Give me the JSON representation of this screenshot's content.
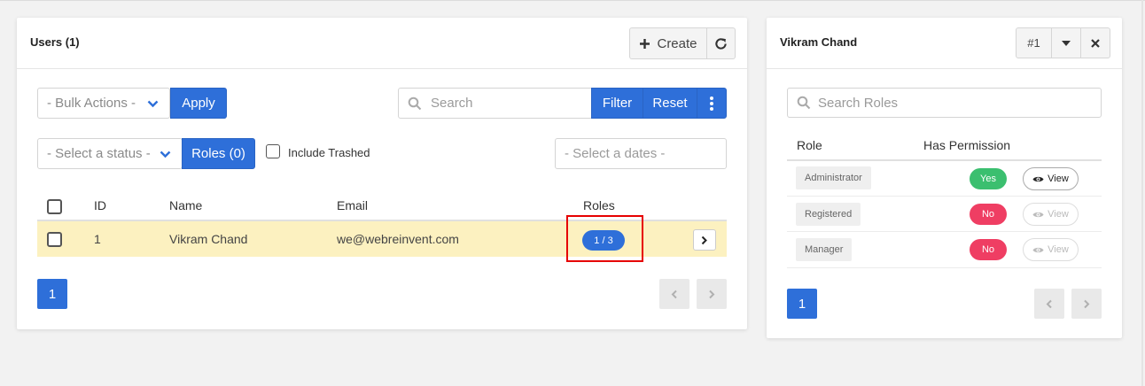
{
  "users_panel": {
    "title": "Users (1)",
    "create_label": "Create",
    "bulk_actions_placeholder": "- Bulk Actions -",
    "apply_label": "Apply",
    "search_placeholder": "Search",
    "filter_label": "Filter",
    "reset_label": "Reset",
    "status_placeholder": "- Select a status -",
    "roles_filter_label": "Roles (0)",
    "include_trashed_label": "Include Trashed",
    "dates_placeholder": "- Select a dates -",
    "columns": [
      "ID",
      "Name",
      "Email",
      "Roles"
    ],
    "rows": [
      {
        "id": "1",
        "name": "Vikram Chand",
        "email": "we@webreinvent.com",
        "roles": "1 / 3"
      }
    ],
    "current_page": "1"
  },
  "roles_panel": {
    "title": "Vikram Chand",
    "record_number": "#1",
    "search_placeholder": "Search Roles",
    "columns": [
      "Role",
      "Has Permission"
    ],
    "rows": [
      {
        "role": "Administrator",
        "permission": "Yes",
        "view_label": "View",
        "enabled": true
      },
      {
        "role": "Registered",
        "permission": "No",
        "view_label": "View",
        "enabled": false
      },
      {
        "role": "Manager",
        "permission": "No",
        "view_label": "View",
        "enabled": false
      }
    ],
    "current_page": "1"
  },
  "colors": {
    "primary": "#2e6fd9",
    "yes": "#3bbf6f",
    "no": "#ef3e63",
    "highlight_row": "#fcf1c0",
    "annotation": "#e60000"
  }
}
